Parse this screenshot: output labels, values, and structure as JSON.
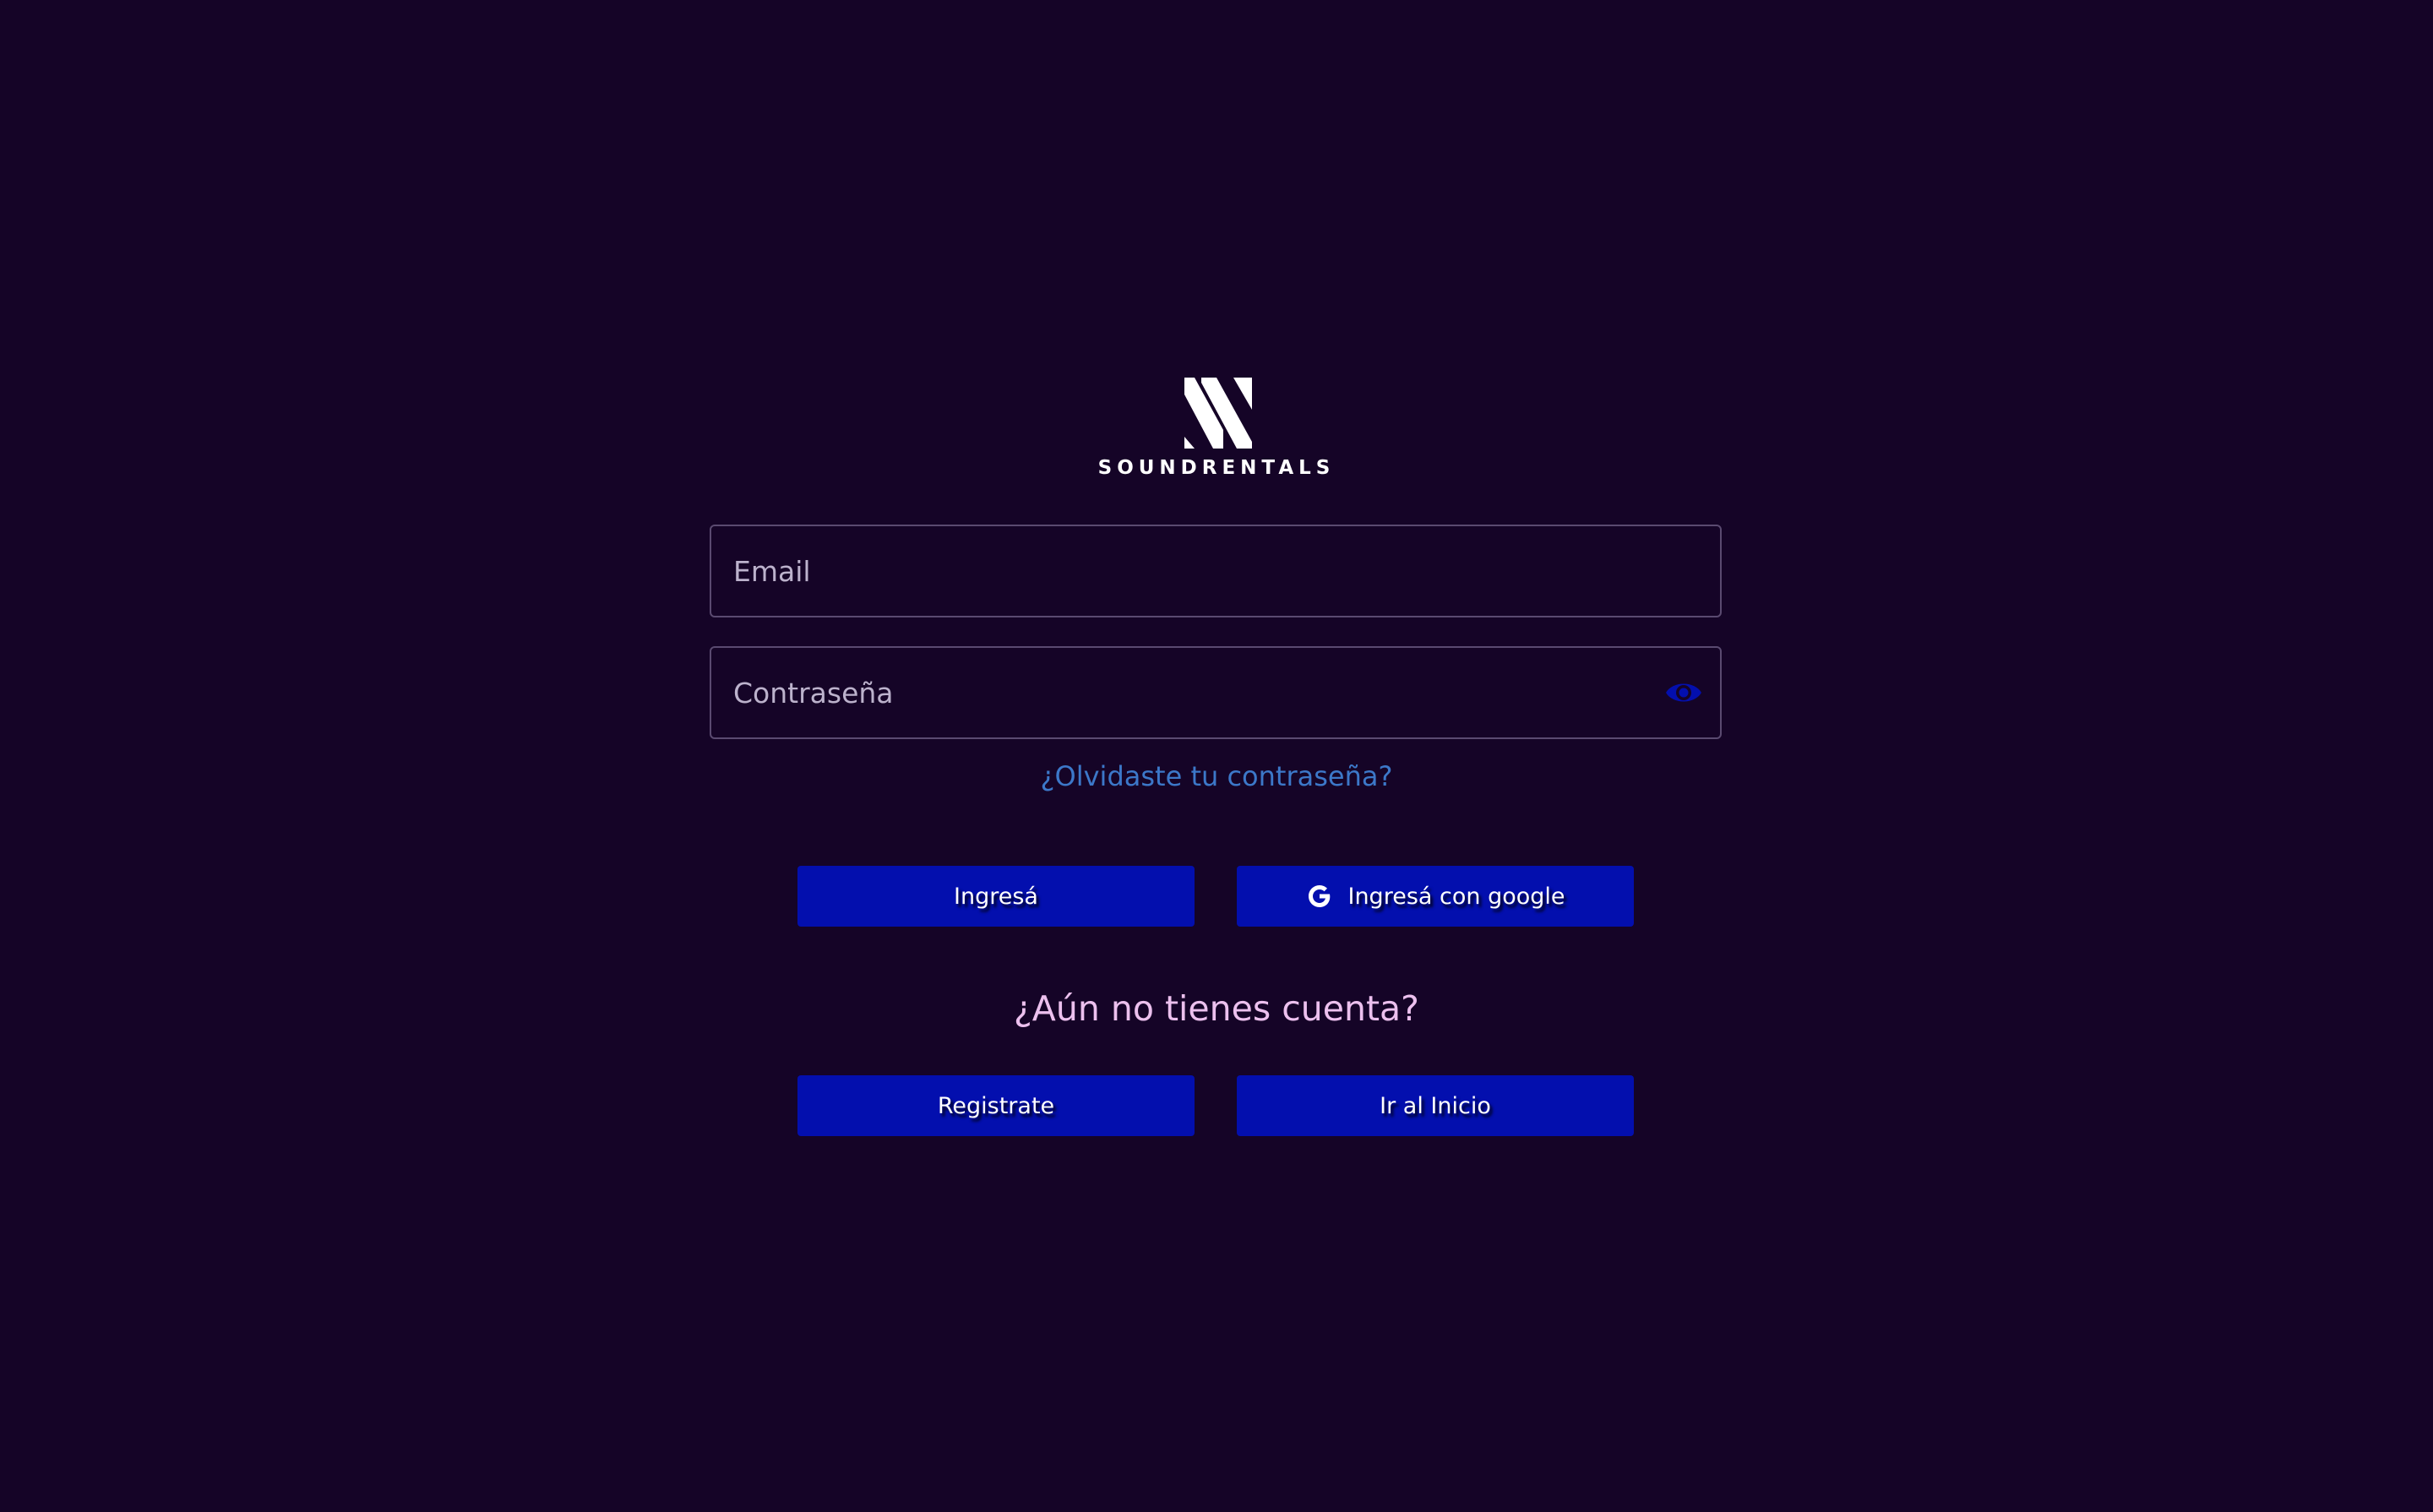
{
  "brand": {
    "name": "SOUNDRENTALS",
    "logo_icon": "soundrentals-logo-icon"
  },
  "form": {
    "email_placeholder": "Email",
    "password_placeholder": "Contraseña",
    "show_password_icon": "eye-icon",
    "forgot_password_label": "¿Olvidaste tu contraseña?"
  },
  "buttons": {
    "login_label": "Ingresá",
    "google_label": "Ingresá con google",
    "google_icon": "google-icon",
    "register_label": "Registrate",
    "home_label": "Ir al Inicio"
  },
  "no_account_text": "¿Aún no tienes cuenta?",
  "colors": {
    "background": "#150427",
    "button": "#030fae",
    "link": "#3c78c9",
    "prompt_text": "#ecc0ee",
    "field_border": "#5a4a70"
  }
}
